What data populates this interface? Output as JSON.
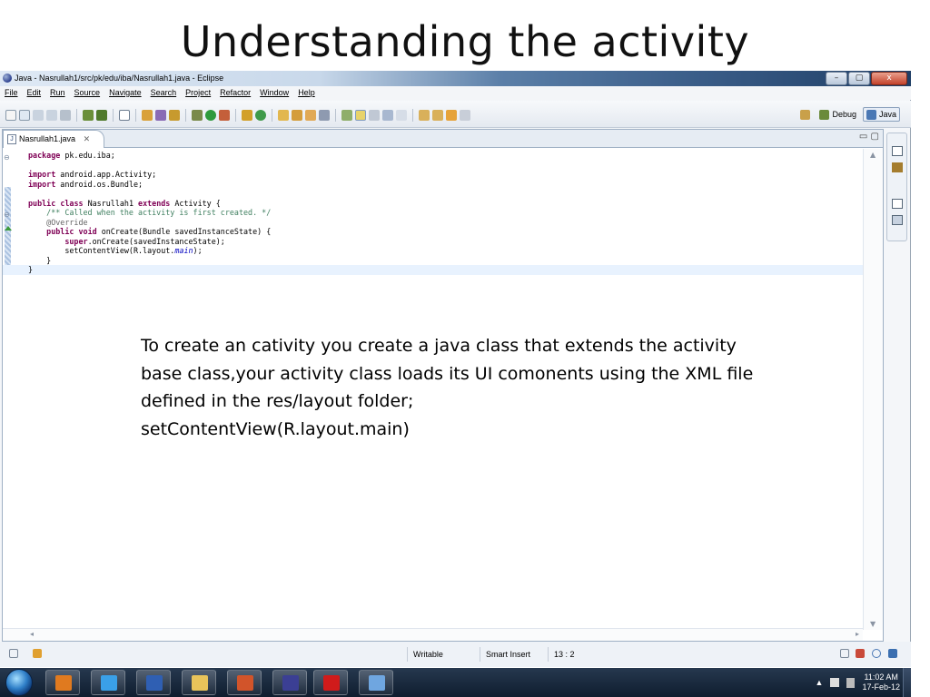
{
  "slide": {
    "title": "Understanding the activity",
    "body_lines": [
      "To create an cativity you create a  java class that extends the activity",
      "base class,your activity class loads its UI comonents using the XML file",
      "defined in the  res/layout folder;",
      "setContentView(R.layout.main)"
    ]
  },
  "window": {
    "title": "Java - Nasrullah1/src/pk/edu/iba/Nasrullah1.java - Eclipse",
    "buttons": {
      "minimize": "–",
      "maximize": "▢",
      "close": "x"
    }
  },
  "menu": [
    "File",
    "Edit",
    "Run",
    "Source",
    "Navigate",
    "Search",
    "Project",
    "Refactor",
    "Window",
    "Help"
  ],
  "toolbar": {
    "perspectives": [
      {
        "label": "",
        "icon": "open-perspective-icon",
        "active": false
      },
      {
        "label": "Debug",
        "icon": "debug-perspective-icon",
        "active": false
      },
      {
        "label": "Java",
        "icon": "java-perspective-icon",
        "active": true
      }
    ]
  },
  "editor": {
    "tab_label": "Nasrullah1.java",
    "tab_close": "✕",
    "minmax": "▭ ▢",
    "code_lines": [
      [
        {
          "t": "package",
          "c": "kw"
        },
        {
          "t": " pk.edu.iba;"
        }
      ],
      [
        {
          "t": ""
        }
      ],
      [
        {
          "t": "import",
          "c": "kw"
        },
        {
          "t": " android.app.Activity;"
        }
      ],
      [
        {
          "t": "import",
          "c": "kw"
        },
        {
          "t": " android.os.Bundle;"
        }
      ],
      [
        {
          "t": ""
        }
      ],
      [
        {
          "t": "public",
          "c": "kw"
        },
        {
          "t": " "
        },
        {
          "t": "class",
          "c": "kw"
        },
        {
          "t": " Nasrullah1 "
        },
        {
          "t": "extends",
          "c": "kw"
        },
        {
          "t": " Activity {"
        }
      ],
      [
        {
          "t": "    "
        },
        {
          "t": "/** Called when the activity is first created. */",
          "c": "cm"
        }
      ],
      [
        {
          "t": "    "
        },
        {
          "t": "@Override",
          "c": "an"
        }
      ],
      [
        {
          "t": "    "
        },
        {
          "t": "public",
          "c": "kw"
        },
        {
          "t": " "
        },
        {
          "t": "void",
          "c": "kw"
        },
        {
          "t": " onCreate(Bundle savedInstanceState) {"
        }
      ],
      [
        {
          "t": "        "
        },
        {
          "t": "super",
          "c": "kw"
        },
        {
          "t": ".onCreate(savedInstanceState);"
        }
      ],
      [
        {
          "t": "        setContentView(R.layout."
        },
        {
          "t": "main",
          "c": "fld"
        },
        {
          "t": ");"
        }
      ],
      [
        {
          "t": "    }"
        }
      ],
      [
        {
          "t": "}"
        }
      ]
    ],
    "current_line": 12
  },
  "status": {
    "mode": "Writable",
    "insert_mode": "Smart Insert",
    "position": "13 : 2"
  },
  "taskbar": {
    "clock_time": "11:02 AM",
    "clock_date": "17-Feb-12",
    "tray_arrow": "▲",
    "apps": [
      {
        "name": "media-player-icon",
        "color": "#e07a1f"
      },
      {
        "name": "internet-explorer-icon",
        "color": "#3aa0e8"
      },
      {
        "name": "word-icon",
        "color": "#2f5fb3"
      },
      {
        "name": "file-explorer-icon",
        "color": "#e8c35a"
      },
      {
        "name": "powerpoint-icon",
        "color": "#d2542a"
      },
      {
        "name": "eclipse-icon",
        "color": "#3b3f94"
      },
      {
        "name": "acrobat-icon",
        "color": "#d01b1b"
      },
      {
        "name": "network-icon",
        "color": "#6fa6e0"
      }
    ]
  }
}
